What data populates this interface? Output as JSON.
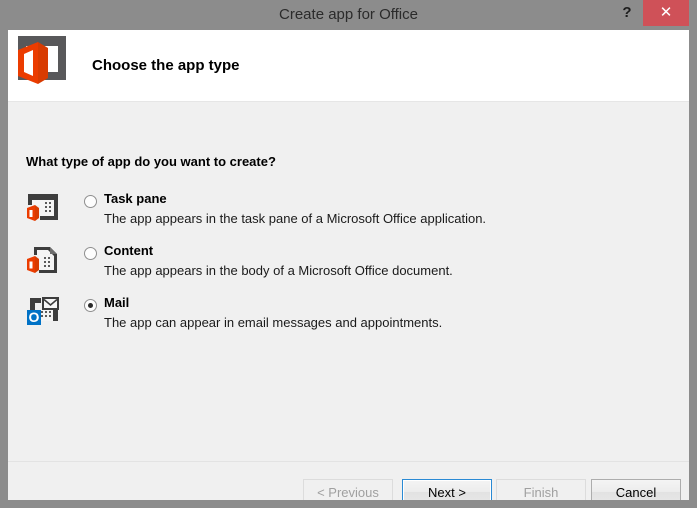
{
  "window": {
    "title": "Create app for Office",
    "help_label": "?",
    "close_label": "✕"
  },
  "header": {
    "title": "Choose the app type",
    "logo_icon": "office-logo-icon"
  },
  "body": {
    "question": "What type of app do you want to create?",
    "options": [
      {
        "id": "task-pane",
        "label": "Task pane",
        "description": "The app appears in the task pane of a Microsoft Office application.",
        "selected": false,
        "icon": "task-pane-icon"
      },
      {
        "id": "content",
        "label": "Content",
        "description": "The app appears in the body of a Microsoft Office document.",
        "selected": false,
        "icon": "content-document-icon"
      },
      {
        "id": "mail",
        "label": "Mail",
        "description": "The app can appear in email messages and appointments.",
        "selected": true,
        "icon": "mail-envelope-icon"
      }
    ]
  },
  "footer": {
    "previous_label": "< Previous",
    "next_label": "Next >",
    "finish_label": "Finish",
    "cancel_label": "Cancel"
  },
  "colors": {
    "titlebar": "#8c8c8c",
    "close_button": "#cf5158",
    "body": "#f0f0f0",
    "office_orange": "#eb3c00",
    "outlook_blue": "#0072c6",
    "icon_gray": "#4d4d4d",
    "focus_blue": "#2a8ad4"
  }
}
